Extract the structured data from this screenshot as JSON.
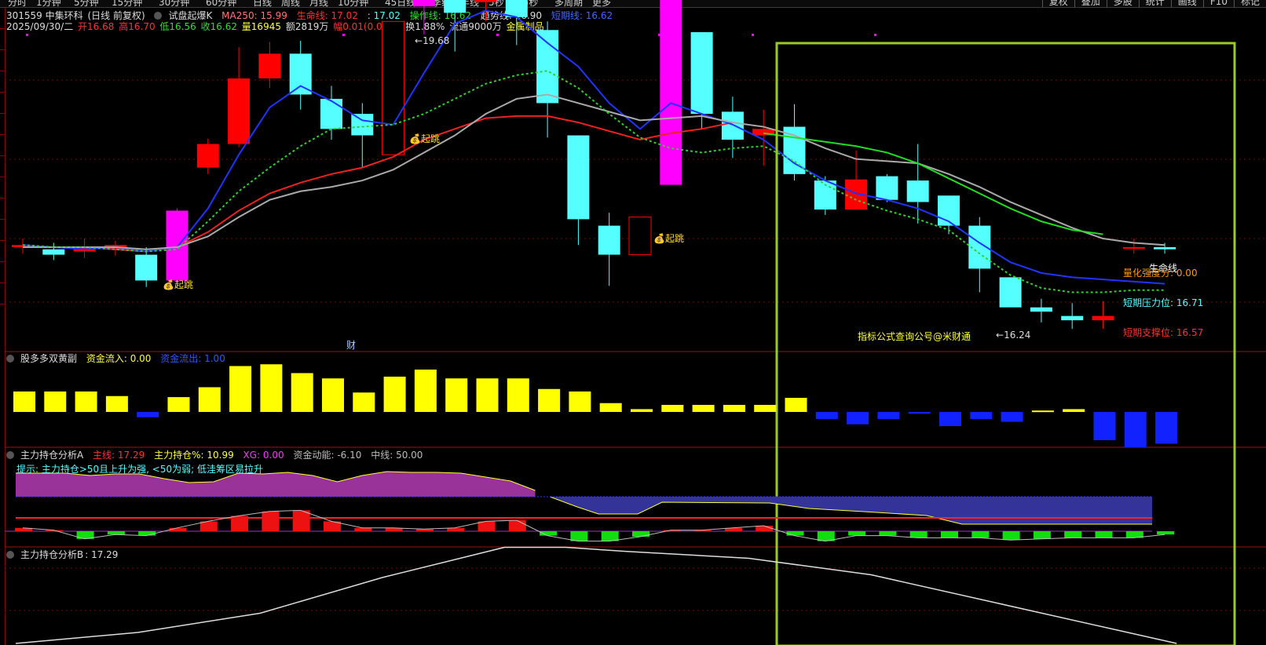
{
  "topbar": {
    "periods": [
      "分时",
      "1分钟",
      "5分钟",
      "15分钟",
      "30分钟",
      "60分钟",
      "日线",
      "周线",
      "月线",
      "10分钟",
      "45日线",
      "季线",
      "年线",
      "5秒",
      "15秒",
      "多周期",
      "更多"
    ],
    "right_buttons": [
      "复权",
      "叠加",
      "多股",
      "统计",
      "画线",
      "F10",
      "标记"
    ]
  },
  "stock_header": {
    "code_name": "301559 中集环科",
    "adjust": "(日线 前复权)",
    "indicator_name": "试盘起爆K",
    "ma250": "MA250: 15.99",
    "lifeline": "生命线: 17.02",
    "lifeline2": ": 17.02",
    "operate": "操作线: 16.62",
    "trend": "趋势线: 16.90",
    "short": "短期线: 16.62"
  },
  "quote_line": {
    "date": "2025/09/30/二",
    "open": "开16.68",
    "high": "高16.70",
    "low": "低16.56",
    "close": "收16.62",
    "volume": "量16945",
    "amount": "额2819万",
    "change": "幅0.01(0.06%)",
    "turnover": "换1.88%",
    "float": "流通9000万",
    "industry": "金属制品"
  },
  "main_chart": {
    "high_marker": "19.68",
    "low_marker": "16.24",
    "signal_label": "起跳",
    "cai_label": "财",
    "promo_text": "指标公式查询公号@米财通",
    "right_labels": {
      "lifeline": "生命线",
      "quant_strength": "量化强度分: 0.00",
      "short_pressure": "短期压力位: 16.71",
      "short_support": "短期支撑位: 16.57"
    }
  },
  "panel1": {
    "name": "股多多双黄副",
    "inflow": "资金流入: 0.00",
    "outflow": "资金流出: 1.00"
  },
  "panel2": {
    "name": "主力持仓分析A",
    "main_line": "主线: 17.29",
    "hold_pct": "主力持仓%: 10.99",
    "xg": "XG: 0.00",
    "momentum": "资金动能: -6.10",
    "mid_line": "中线: 50.00",
    "hint": "提示: 主力持仓>50且上升为强, <50为弱; 低洼筹区易拉升"
  },
  "panel3": {
    "name": "主力持仓分析B",
    "value": ": 17.29"
  },
  "colors": {
    "up": "#ff0000",
    "down": "#55ffff",
    "signal": "#ff00ff",
    "yellow": "#ffff00",
    "highlight_box": "#99cc22"
  },
  "chart_data": [
    {
      "type": "candlestick",
      "title": "301559 中集环科 日线",
      "candles": [
        {
          "o": 16.62,
          "h": 16.7,
          "l": 16.56,
          "c": 16.64
        },
        {
          "o": 16.6,
          "h": 16.66,
          "l": 16.5,
          "c": 16.55
        },
        {
          "o": 16.58,
          "h": 16.7,
          "l": 16.52,
          "c": 16.62
        },
        {
          "o": 16.6,
          "h": 16.68,
          "l": 16.54,
          "c": 16.64
        },
        {
          "o": 16.55,
          "h": 16.62,
          "l": 16.25,
          "c": 16.31
        },
        {
          "o": 16.31,
          "h": 16.98,
          "l": 16.28,
          "c": 16.96
        },
        {
          "o": 17.36,
          "h": 17.63,
          "l": 17.3,
          "c": 17.58
        },
        {
          "o": 17.58,
          "h": 18.48,
          "l": 17.55,
          "c": 18.19
        },
        {
          "o": 18.19,
          "h": 18.53,
          "l": 18.1,
          "c": 18.42
        },
        {
          "o": 18.42,
          "h": 18.54,
          "l": 17.9,
          "c": 18.04
        },
        {
          "o": 18.0,
          "h": 18.12,
          "l": 17.62,
          "c": 17.72
        },
        {
          "o": 17.86,
          "h": 17.96,
          "l": 17.36,
          "c": 17.66
        },
        {
          "o": 17.48,
          "h": 18.62,
          "l": 17.48,
          "c": 18.72
        },
        {
          "o": 18.86,
          "h": 19.68,
          "l": 18.6,
          "c": 19.15
        },
        {
          "o": 19.15,
          "h": 19.48,
          "l": 18.44,
          "c": 18.8
        },
        {
          "o": 18.9,
          "h": 18.95,
          "l": 18.72,
          "c": 18.92
        },
        {
          "o": 18.96,
          "h": 19.4,
          "l": 18.5,
          "c": 18.76
        },
        {
          "o": 18.64,
          "h": 18.72,
          "l": 17.64,
          "c": 17.96
        },
        {
          "o": 17.66,
          "h": 17.66,
          "l": 16.64,
          "c": 16.88
        },
        {
          "o": 16.82,
          "h": 16.94,
          "l": 16.26,
          "c": 16.55
        },
        {
          "o": 16.55,
          "h": 16.9,
          "l": 16.55,
          "c": 16.9
        },
        {
          "o": 17.2,
          "h": 18.9,
          "l": 17.2,
          "c": 18.92
        },
        {
          "o": 18.62,
          "h": 18.62,
          "l": 17.72,
          "c": 17.86
        },
        {
          "o": 17.88,
          "h": 18.02,
          "l": 17.45,
          "c": 17.62
        },
        {
          "o": 17.66,
          "h": 17.9,
          "l": 17.38,
          "c": 17.72
        },
        {
          "o": 17.74,
          "h": 17.95,
          "l": 17.24,
          "c": 17.3
        },
        {
          "o": 17.24,
          "h": 17.28,
          "l": 16.92,
          "c": 16.97
        },
        {
          "o": 16.97,
          "h": 17.52,
          "l": 16.97,
          "c": 17.25
        },
        {
          "o": 17.28,
          "h": 17.3,
          "l": 17.04,
          "c": 17.06
        },
        {
          "o": 17.24,
          "h": 17.58,
          "l": 16.84,
          "c": 17.04
        },
        {
          "o": 17.1,
          "h": 17.1,
          "l": 16.74,
          "c": 16.82
        },
        {
          "o": 16.82,
          "h": 16.9,
          "l": 16.2,
          "c": 16.42
        },
        {
          "o": 16.34,
          "h": 16.34,
          "l": 16.24,
          "c": 16.06
        },
        {
          "o": 16.06,
          "h": 16.14,
          "l": 15.92,
          "c": 16.02
        },
        {
          "o": 15.98,
          "h": 16.1,
          "l": 15.86,
          "c": 15.94
        },
        {
          "o": 15.94,
          "h": 16.12,
          "l": 15.86,
          "c": 15.98
        },
        {
          "o": 16.62,
          "h": 16.7,
          "l": 16.56,
          "c": 16.62
        },
        {
          "o": 16.62,
          "h": 16.66,
          "l": 16.56,
          "c": 16.6
        }
      ],
      "series": [
        {
          "name": "生命线",
          "color": "#ff2222"
        },
        {
          "name": "操作线",
          "color": "#2222ff"
        },
        {
          "name": "趋势线",
          "color": "#bbbbbb"
        },
        {
          "name": "短期线",
          "color": "#22cc22"
        }
      ]
    },
    {
      "type": "bar",
      "title": "股多多双黄副",
      "values": [
        0.58,
        0.58,
        0.58,
        0.45,
        -0.15,
        0.42,
        0.7,
        1.3,
        1.35,
        1.1,
        0.95,
        0.55,
        1.0,
        1.2,
        0.95,
        0.95,
        0.95,
        0.65,
        0.58,
        0.25,
        0.08,
        0.2,
        0.2,
        0.2,
        0.2,
        0.4,
        -0.2,
        -0.35,
        -0.2,
        -0.05,
        -0.4,
        -0.2,
        -0.28,
        0.04,
        0.08,
        -0.8,
        -1.0,
        -0.9
      ]
    },
    {
      "type": "bar",
      "title": "主力持仓分析A",
      "values": [
        0.3,
        0.1,
        -0.7,
        -0.3,
        -0.4,
        0.3,
        0.9,
        1.4,
        1.8,
        1.9,
        0.9,
        0.3,
        0.3,
        0.2,
        0.3,
        0.9,
        1.0,
        -0.4,
        -0.9,
        -0.9,
        -0.5,
        0.1,
        0.1,
        0.3,
        0.5,
        -0.4,
        -0.9,
        -0.4,
        -0.4,
        -0.6,
        -0.6,
        -0.6,
        -0.8,
        -0.7,
        -0.6,
        -0.6,
        -0.6,
        -0.3
      ]
    },
    {
      "type": "line",
      "title": "主力持仓分析B",
      "x": [
        0,
        4,
        8,
        12,
        16,
        18,
        20,
        24,
        28,
        32,
        36,
        38
      ],
      "values": [
        0,
        8,
        22,
        48,
        70,
        70,
        67,
        62,
        50,
        30,
        10,
        0
      ]
    }
  ]
}
